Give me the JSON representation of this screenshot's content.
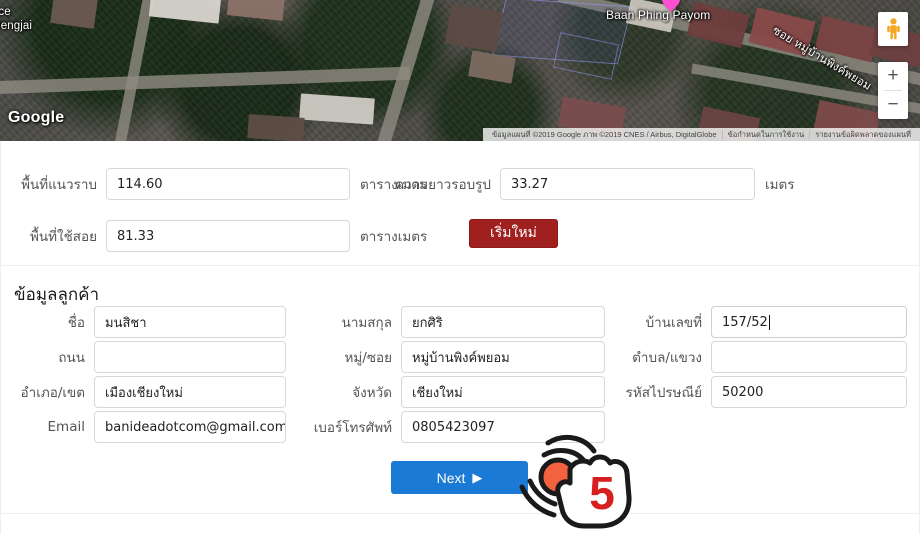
{
  "map": {
    "labels": {
      "service_partial": "rvice",
      "mengjai_partial": "nt Mengjai",
      "baan_phing_payom": "Baan Phing Payom",
      "soi_thai": "ซอย หมู่บ้านพิงค์พยอม"
    },
    "logo": "Google",
    "marker_name": "map-pin-marker",
    "attribution": {
      "map_data": "ข้อมูลแผนที่ ©2019 Google ภาพ ©2019 CNES / Airbus, DigitalGlobe",
      "terms": "ข้อกำหนดในการใช้งาน",
      "report": "รายงานข้อผิดพลาดของแผนที่"
    },
    "controls": {
      "pegman": "street-view-pegman",
      "zoom_in": "+",
      "zoom_out": "−"
    }
  },
  "measurements": {
    "area_flat": {
      "label": "พื้นที่แนวราบ",
      "value": "114.60",
      "unit": "ตารางเมตร"
    },
    "area_usable": {
      "label": "พื้นที่ใช้สอย",
      "value": "81.33",
      "unit": "ตารางเมตร"
    },
    "perimeter": {
      "label": "ความยาวรอบรูป",
      "value": "33.27",
      "unit": "เมตร"
    },
    "restart_button": "เริ่มใหม่"
  },
  "customer": {
    "section_title": "ข้อมูลลูกค้า",
    "fields": {
      "first_name": {
        "label": "ชื่อ",
        "value": "มนสิชา"
      },
      "last_name": {
        "label": "นามสกุล",
        "value": "ยกศิริ"
      },
      "house_no": {
        "label": "บ้านเลขที่",
        "value": "157/52"
      },
      "road": {
        "label": "ถนน",
        "value": ""
      },
      "moo_soi": {
        "label": "หมู่/ซอย",
        "value": "หมู่บ้านพิงค์พยอม"
      },
      "subdistrict": {
        "label": "ตำบล/แขวง",
        "value": ""
      },
      "district": {
        "label": "อำเภอ/เขต",
        "value": "เมืองเชียงใหม่"
      },
      "province": {
        "label": "จังหวัด",
        "value": "เชียงใหม่"
      },
      "postcode": {
        "label": "รหัสไปรษณีย์",
        "value": "50200"
      },
      "email": {
        "label": "Email",
        "value": "banideadotcom@gmail.com"
      },
      "phone": {
        "label": "เบอร์โทรศัพท์",
        "value": "0805423097"
      }
    }
  },
  "footer": {
    "next_button": "Next",
    "next_arrow": "▶"
  },
  "annotation": {
    "step_number": "5",
    "icon": "hand-tap-icon"
  },
  "colors": {
    "primary_blue": "#1b7ad6",
    "restart_red": "#a01f1f",
    "annotation_red": "#d81f1f",
    "marker_pink": "#ff4fd1",
    "pegman_orange": "#f5a623"
  }
}
